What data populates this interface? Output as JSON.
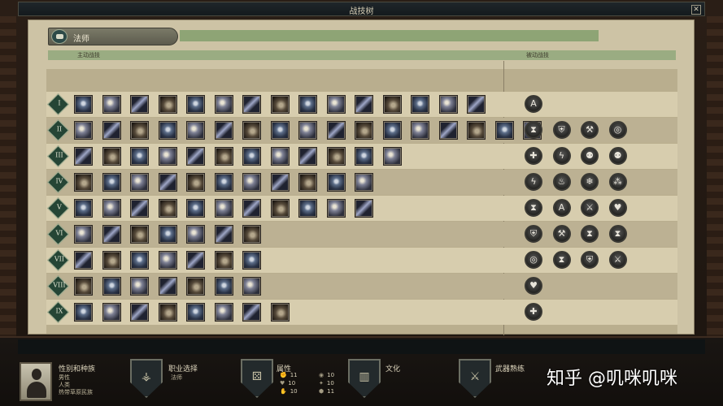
{
  "window": {
    "title": "战技树",
    "close_label": "✕"
  },
  "class_header": {
    "name": "法师",
    "icon": "book-icon"
  },
  "columns": {
    "active": "主动战技",
    "passive": "被动战技"
  },
  "tiers": [
    {
      "numeral": "I",
      "active_count": 15,
      "passive": [
        "A"
      ]
    },
    {
      "numeral": "II",
      "active_count": 17,
      "passive": [
        "⧗",
        "⛨",
        "⚒",
        "◎"
      ]
    },
    {
      "numeral": "III",
      "active_count": 12,
      "passive": [
        "✚",
        "ϟ",
        "⚉",
        "⚉"
      ]
    },
    {
      "numeral": "IV",
      "active_count": 11,
      "passive": [
        "ϟ",
        "♨",
        "❄",
        "⁂"
      ]
    },
    {
      "numeral": "V",
      "active_count": 11,
      "passive": [
        "⧗",
        "A",
        "⚔",
        "♥"
      ]
    },
    {
      "numeral": "VI",
      "active_count": 7,
      "passive": [
        "⛨",
        "⚒",
        "⧗",
        "⧗"
      ]
    },
    {
      "numeral": "VII",
      "active_count": 7,
      "passive": [
        "◎",
        "⧗",
        "⛨",
        "⚔"
      ]
    },
    {
      "numeral": "VIII",
      "active_count": 7,
      "passive": [
        "♥"
      ]
    },
    {
      "numeral": "IX",
      "active_count": 8,
      "passive": [
        "✚"
      ]
    }
  ],
  "bottom": {
    "gender_race": {
      "title": "性别和种族",
      "lines": [
        "男性",
        "人类",
        "热带草原民族"
      ]
    },
    "class_select": {
      "title": "职业选择",
      "value": "法师"
    },
    "attributes": {
      "title": "属性",
      "left": [
        "11",
        "10",
        "10"
      ],
      "right": [
        "10",
        "10",
        "11"
      ]
    },
    "culture": {
      "title": "文化"
    },
    "weapons": {
      "title": "武器熟练"
    }
  },
  "watermark": "知乎 @叽咪叽咪"
}
